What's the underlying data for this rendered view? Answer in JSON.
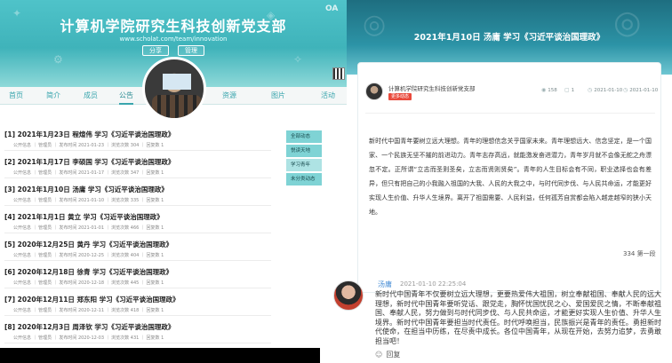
{
  "left": {
    "site_title": "计算机学院研究生科技创新党支部",
    "site_url": "www.scholat.com/team/innovation",
    "share_label": "分享",
    "manage_label": "管理",
    "nav": [
      "首页",
      "简介",
      "成员",
      "公告",
      "资源",
      "图片",
      "活动"
    ],
    "active_nav": 3,
    "posts": [
      {
        "title": "[1]  2021年1月23日 程煊伟 学习《习近平谈治国理政》",
        "meta": "公开信息  ｜  管理员  ｜  发布时间 2021-01-23  ｜  浏览次数 304  ｜  回复数 1"
      },
      {
        "title": "[2]  2021年1月17日 李硕国 学习《习近平谈治国理政》",
        "meta": "公开信息  ｜  管理员  ｜  发布时间 2021-01-17  ｜  浏览次数 347  ｜  回复数 1"
      },
      {
        "title": "[3]  2021年1月10日 汤庸 学习《习近平谈治国理政》",
        "meta": "公开信息  ｜  管理员  ｜  发布时间 2021-01-10  ｜  浏览次数 335  ｜  回复数 1"
      },
      {
        "title": "[4]  2021年1月1日 黄立 学习《习近平谈治国理政》",
        "meta": "公开信息  ｜  管理员  ｜  发布时间 2021-01-01  ｜  浏览次数 466  ｜  回复数 1"
      },
      {
        "title": "[5]  2020年12月25日 黄丹 学习《习近平谈治国理政》",
        "meta": "公开信息  ｜  管理员  ｜  发布时间 2020-12-25  ｜  浏览次数 404  ｜  回复数 1"
      },
      {
        "title": "[6]  2020年12月18日 徐青 学习《习近平谈治国理政》",
        "meta": "公开信息  ｜  管理员  ｜  发布时间 2020-12-18  ｜  浏览次数 445  ｜  回复数 1"
      },
      {
        "title": "[7]  2020年12月11日 郑东阳 学习《习近平谈治国理政》",
        "meta": "公开信息  ｜  管理员  ｜  发布时间 2020-12-11  ｜  浏览次数 418  ｜  回复数 1"
      },
      {
        "title": "[8]  2020年12月3日 周泽钦 学习《习近平谈治国理政》",
        "meta": "公开信息  ｜  管理员  ｜  发布时间 2020-12-03  ｜  浏览次数 431  ｜  回复数 1"
      }
    ],
    "side_menu": [
      "全部动态",
      "悦读天地",
      "学习青年",
      "未分类动态"
    ],
    "side_active": 2,
    "accent": "#3fb3ba"
  },
  "right": {
    "title": "2021年1月10日 汤庸 学习《习近平谈治国理政》",
    "author": "计算机学院研究生科技创新党支部",
    "tag": "更多动态",
    "views": "158",
    "replies": "1",
    "date1": "2021-01-10",
    "date2": "2021-01-10",
    "body": "新时代中国青年要树立远大理想。青年的理想信念关乎国家未来。青年理想远大、信念坚定，是一个国家、一个民族无坚不摧的前进动力。青年志存高远，就能激发奋进潜力，青年岁月就不会像无舵之舟漂忽不定。正所谓“立志而圣则圣矣，立志而贤则贤矣”。青年的人生目标会有不同，职业选择也会有差异，但只有把自己的小我融入祖国的大我、人民的大我之中，与时代同步伐、与人民共命运，才能更好实现人生价值、升华人生境界。离开了祖国需要、人民利益，任何孤芳自赏都会陷入越走越窄的狭小天地。",
    "page_label": "334 第一段"
  },
  "comment": {
    "name": "汤庸",
    "time": "2021-01-10 22:25:04",
    "text": "新时代中国青年不仅要树立远大理想，更要热爱伟大祖国，树立奉献祖国、奉献人民的远大理想，新时代中国青年要听党话、跟党走，胸怀忧国忧民之心、爱国爱民之情，不断奉献祖国、奉献人民，努力做到与时代同步伐、与人民共命运，才能更好实现人生价值、升华人生境界。新时代中国青年要担当时代责任。时代呼唤担当，民族振兴是青年的责任。勇担新时代使命，在担当中历练，在尽责中成长。各位中国青年，从现在开始，去努力追梦，去勇敢担当吧！",
    "reply_label": "回复"
  }
}
